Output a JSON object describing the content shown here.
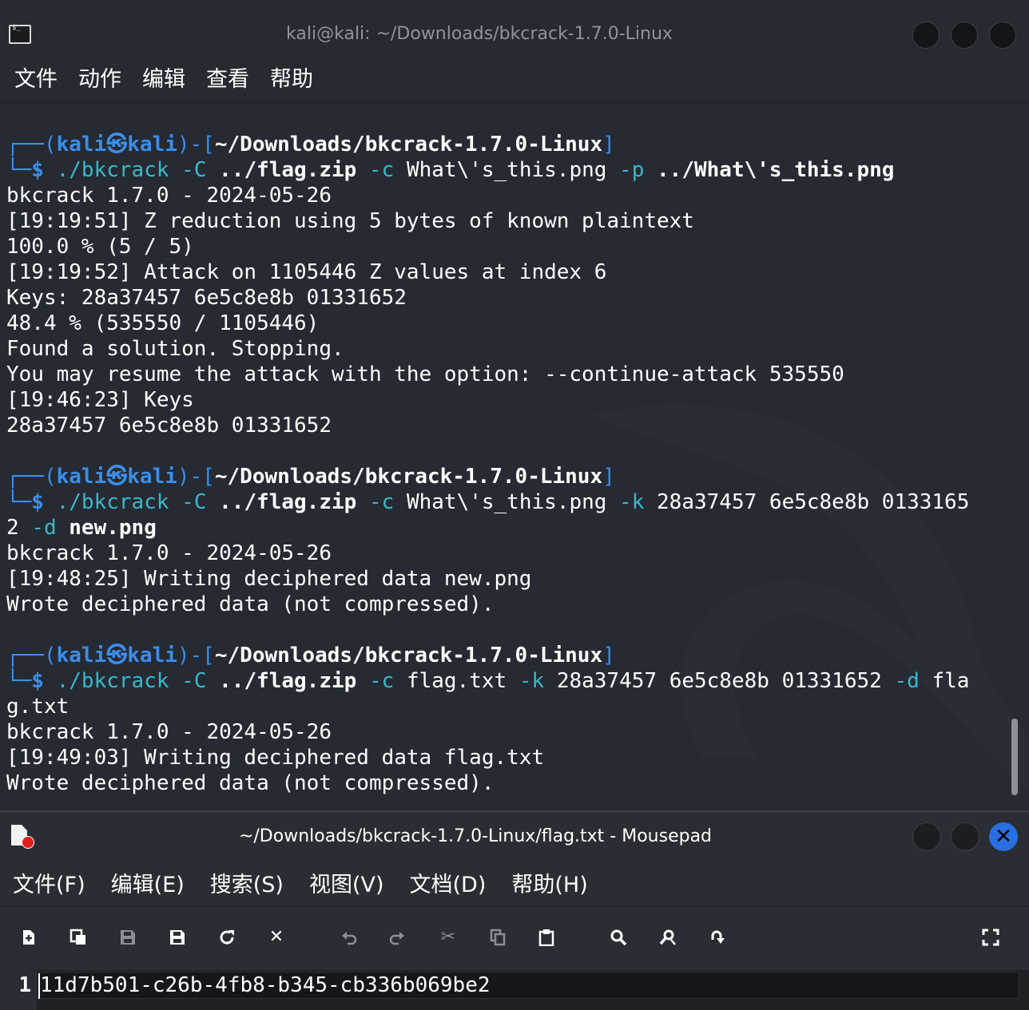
{
  "terminal": {
    "title": "kali@kali: ~/Downloads/bkcrack-1.7.0-Linux",
    "menu": [
      "文件",
      "动作",
      "编辑",
      "查看",
      "帮助"
    ],
    "prompt": {
      "open": "┌──(",
      "user": "kali",
      "at": "㉿",
      "host": "kali",
      "mid": ")-[",
      "path": "~/Downloads/bkcrack-1.7.0-Linux",
      "close": "]",
      "dollar": "└─$"
    },
    "cmd1": {
      "prog": " ./bkcrack",
      "o1": " -C ",
      "a1": "../flag.zip",
      "o2": " -c ",
      "a2": "What\\'s_this.png",
      "o3": " -p ",
      "a3": "../What\\'s_this.png"
    },
    "out1": [
      "bkcrack 1.7.0 - 2024-05-26",
      "[19:19:51] Z reduction using 5 bytes of known plaintext",
      "100.0 % (5 / 5)",
      "[19:19:52] Attack on 1105446 Z values at index 6",
      "Keys: 28a37457 6e5c8e8b 01331652",
      "48.4 % (535550 / 1105446)",
      "Found a solution. Stopping.",
      "You may resume the attack with the option: --continue-attack 535550",
      "[19:46:23] Keys",
      "28a37457 6e5c8e8b 01331652"
    ],
    "cmd2": {
      "prog": " ./bkcrack",
      "o1": " -C ",
      "a1": "../flag.zip",
      "o2": " -c ",
      "a2": "What\\'s_this.png",
      "o3": " -k ",
      "a3": "28a37457 6e5c8e8b 0133165",
      "wrap": "2",
      "o4": " -d ",
      "a4": "new.png"
    },
    "out2": [
      "bkcrack 1.7.0 - 2024-05-26",
      "[19:48:25] Writing deciphered data new.png",
      "Wrote deciphered data (not compressed)."
    ],
    "cmd3": {
      "prog": " ./bkcrack",
      "o1": " -C ",
      "a1": "../flag.zip",
      "o2": " -c ",
      "a2": "flag.txt",
      "o3": " -k ",
      "a3": "28a37457 6e5c8e8b 01331652",
      "o4": " -d ",
      "a4": "fla",
      "wrap": "g.txt"
    },
    "out3": [
      "bkcrack 1.7.0 - 2024-05-26",
      "[19:49:03] Writing deciphered data flag.txt",
      "Wrote deciphered data (not compressed)."
    ]
  },
  "mousepad": {
    "title": "~/Downloads/bkcrack-1.7.0-Linux/flag.txt - Mousepad",
    "menu": [
      "文件(F)",
      "编辑(E)",
      "搜索(S)",
      "视图(V)",
      "文档(D)",
      "帮助(H)"
    ],
    "toolbar_icons": [
      "new-document-icon",
      "new-window-icon",
      "save-icon",
      "save-as-icon",
      "reload-icon",
      "close-icon",
      "undo-icon",
      "redo-icon",
      "cut-icon",
      "copy-icon",
      "paste-icon",
      "search-icon",
      "find-replace-icon",
      "go-to-line-icon",
      "fullscreen-icon"
    ],
    "line_number": "1",
    "content": "11d7b501-c26b-4fb8-b345-cb336b069be2"
  },
  "colors": {
    "prompt_blue": "#3b8ee8",
    "option_teal": "#38b9c9",
    "close_button": "#2a6fe0"
  }
}
